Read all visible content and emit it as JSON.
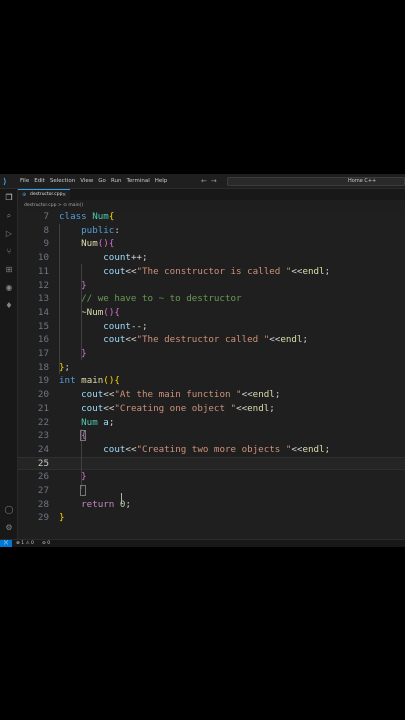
{
  "menu": [
    "File",
    "Edit",
    "Selection",
    "View",
    "Go",
    "Run",
    "Terminal",
    "Help"
  ],
  "search": {
    "text": "Home C++"
  },
  "tab": {
    "label": "destructor.cpp",
    "close": "×"
  },
  "breadcrumb": "destructor.cpp > ⊙ main()",
  "status": {
    "errors": "⊗ 1 ⚠ 0",
    "ports": "⊘ 0"
  },
  "code_lines": [
    {
      "n": "7",
      "html": "<span class=\"kw\">class</span> <span class=\"ty\">Num</span><span class=\"b1\">{</span>"
    },
    {
      "n": "8",
      "html": "    <span class=\"kw\">public</span>:"
    },
    {
      "n": "9",
      "html": "    <span class=\"fn\">Num</span><span class=\"b2\">()</span><span class=\"b2\">{</span>"
    },
    {
      "n": "10",
      "html": "        <span class=\"id\">count</span>++;"
    },
    {
      "n": "11",
      "html": "        <span class=\"id\">cout</span>&lt;&lt;<span class=\"str\">\"The constructor is called \"</span>&lt;&lt;<span class=\"fn\">endl</span>;"
    },
    {
      "n": "12",
      "html": "    <span class=\"b2\">}</span>"
    },
    {
      "n": "13",
      "html": "    <span class=\"cm\">// we have to ~ to destructor</span>"
    },
    {
      "n": "14",
      "html": "    ~<span class=\"fn\">Num</span><span class=\"b2\">()</span><span class=\"b2\">{</span>"
    },
    {
      "n": "15",
      "html": "        <span class=\"id\">count</span>--;"
    },
    {
      "n": "16",
      "html": "        <span class=\"id\">cout</span>&lt;&lt;<span class=\"str\">\"The destructor called \"</span>&lt;&lt;<span class=\"fn\">endl</span>;"
    },
    {
      "n": "17",
      "html": "    <span class=\"b2\">}</span>"
    },
    {
      "n": "18",
      "html": "<span class=\"b1\">}</span>;"
    },
    {
      "n": "19",
      "html": "<span class=\"kw\">int</span> <span class=\"fn\">main</span><span class=\"b1\">()</span><span class=\"b1\">{</span>"
    },
    {
      "n": "20",
      "html": "    <span class=\"id\">cout</span>&lt;&lt;<span class=\"str\">\"At the main function \"</span>&lt;&lt;<span class=\"fn\">endl</span>;"
    },
    {
      "n": "21",
      "html": "    <span class=\"id\">cout</span>&lt;&lt;<span class=\"str\">\"Creating one object \"</span>&lt;&lt;<span class=\"fn\">endl</span>;"
    },
    {
      "n": "22",
      "html": "    <span class=\"ty\">Num</span> <span class=\"id\">a</span>;"
    },
    {
      "n": "23",
      "html": "    <span class=\"b2\">{</span>"
    },
    {
      "n": "24",
      "html": "        <span class=\"id\">cout</span>&lt;&lt;<span class=\"str\">\"Creating two more objects \"</span>&lt;&lt;<span class=\"fn\">endl</span>;"
    },
    {
      "n": "25",
      "html": "        "
    },
    {
      "n": "26",
      "html": "    <span class=\"b2\">}</span>"
    },
    {
      "n": "27",
      "html": ""
    },
    {
      "n": "28",
      "html": "    <span class=\"kw2\">return</span> <span class=\"num\">0</span>;"
    },
    {
      "n": "29",
      "html": "<span class=\"b1\">}</span>"
    }
  ],
  "current_line": "25"
}
